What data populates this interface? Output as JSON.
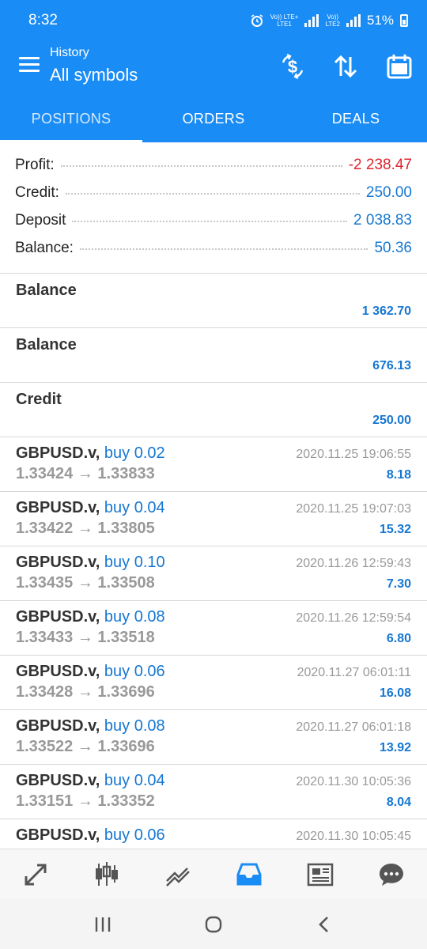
{
  "status": {
    "time": "8:32",
    "sim1": "Vo)) LTE+\nLTE1",
    "sim2": "Vo))\nLTE2",
    "battery": "51%"
  },
  "header": {
    "subtitle": "History",
    "title": "All symbols",
    "actions": [
      "currency-exchange-icon",
      "sort-icon",
      "calendar-icon"
    ]
  },
  "tabs": [
    {
      "label": "POSITIONS",
      "active": true
    },
    {
      "label": "ORDERS",
      "active": false
    },
    {
      "label": "DEALS",
      "active": false
    }
  ],
  "summary": {
    "profit_label": "Profit:",
    "profit": "-2 238.47",
    "credit_label": "Credit:",
    "credit": "250.00",
    "deposit_label": "Deposit",
    "deposit": "2 038.83",
    "balance_label": "Balance:",
    "balance": "50.36"
  },
  "operations": [
    {
      "name": "Balance",
      "amount": "1 362.70"
    },
    {
      "name": "Balance",
      "amount": "676.13"
    },
    {
      "name": "Credit",
      "amount": "250.00"
    }
  ],
  "deals": [
    {
      "symbol": "GBPUSD.v,",
      "direction": "buy 0.02",
      "prices": "1.33424 → 1.33833",
      "time": "2020.11.25 19:06:55",
      "profit": "8.18"
    },
    {
      "symbol": "GBPUSD.v,",
      "direction": "buy 0.04",
      "prices": "1.33422 → 1.33805",
      "time": "2020.11.25 19:07:03",
      "profit": "15.32"
    },
    {
      "symbol": "GBPUSD.v,",
      "direction": "buy 0.10",
      "prices": "1.33435 → 1.33508",
      "time": "2020.11.26 12:59:43",
      "profit": "7.30"
    },
    {
      "symbol": "GBPUSD.v,",
      "direction": "buy 0.08",
      "prices": "1.33433 → 1.33518",
      "time": "2020.11.26 12:59:54",
      "profit": "6.80"
    },
    {
      "symbol": "GBPUSD.v,",
      "direction": "buy 0.06",
      "prices": "1.33428 → 1.33696",
      "time": "2020.11.27 06:01:11",
      "profit": "16.08"
    },
    {
      "symbol": "GBPUSD.v,",
      "direction": "buy 0.08",
      "prices": "1.33522 → 1.33696",
      "time": "2020.11.27 06:01:18",
      "profit": "13.92"
    },
    {
      "symbol": "GBPUSD.v,",
      "direction": "buy 0.04",
      "prices": "1.33151 → 1.33352",
      "time": "2020.11.30 10:05:36",
      "profit": "8.04"
    },
    {
      "symbol": "GBPUSD.v,",
      "direction": "buy 0.06",
      "prices": "",
      "time": "2020.11.30 10:05:45",
      "profit": ""
    }
  ],
  "bottom_nav": [
    {
      "icon": "quotes-icon",
      "active": false
    },
    {
      "icon": "chart-icon",
      "active": false
    },
    {
      "icon": "trade-icon",
      "active": false
    },
    {
      "icon": "history-icon",
      "active": true
    },
    {
      "icon": "news-icon",
      "active": false
    },
    {
      "icon": "messages-icon",
      "active": false
    }
  ],
  "colors": {
    "primary": "#1a8cf5",
    "value_blue": "#1577d2",
    "negative": "#e0242d",
    "nav_active": "#1a8cf5",
    "nav_inactive": "#555555"
  }
}
